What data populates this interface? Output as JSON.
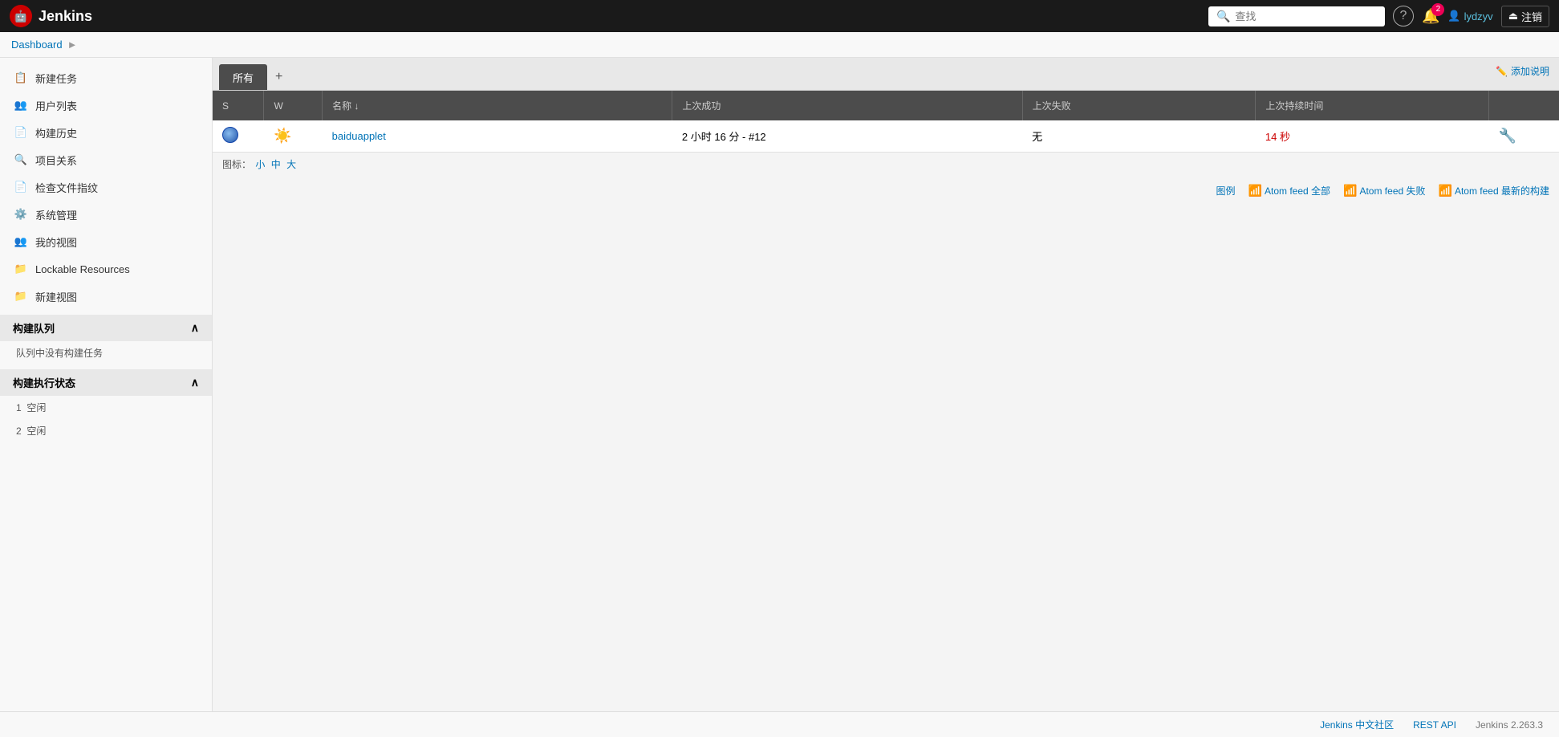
{
  "topnav": {
    "logo_text": "Jenkins",
    "search_placeholder": "查找",
    "notifications_count": "2",
    "user_name": "lydzyv",
    "logout_label": "注销"
  },
  "breadcrumb": {
    "dashboard_label": "Dashboard",
    "separator": "►"
  },
  "sidebar": {
    "items": [
      {
        "id": "new-task",
        "label": "新建任务",
        "icon": "📋"
      },
      {
        "id": "users",
        "label": "用户列表",
        "icon": "👥"
      },
      {
        "id": "build-history",
        "label": "构建历史",
        "icon": "📄"
      },
      {
        "id": "project-relations",
        "label": "项目关系",
        "icon": "🔍"
      },
      {
        "id": "check-file-fingerprint",
        "label": "检查文件指纹",
        "icon": "📄"
      },
      {
        "id": "system-management",
        "label": "系统管理",
        "icon": "⚙️"
      },
      {
        "id": "my-views",
        "label": "我的视图",
        "icon": "👥"
      },
      {
        "id": "lockable-resources",
        "label": "Lockable Resources",
        "icon": "📁"
      },
      {
        "id": "new-view",
        "label": "新建视图",
        "icon": "📁"
      }
    ],
    "build_queue_section": "构建队列",
    "build_queue_empty": "队列中没有构建任务",
    "build_executor_section": "构建执行状态",
    "executors": [
      {
        "id": 1,
        "status": "空闲"
      },
      {
        "id": 2,
        "status": "空闲"
      }
    ]
  },
  "main": {
    "add_desc_label": "添加说明",
    "tabs": [
      {
        "id": "all",
        "label": "所有",
        "active": true
      },
      {
        "id": "add",
        "label": "+"
      }
    ],
    "table": {
      "headers": [
        "S",
        "W",
        "名称 ↓",
        "上次成功",
        "上次失败",
        "上次持续时间",
        ""
      ],
      "rows": [
        {
          "status": "globe",
          "weather": "sun",
          "name": "baiduapplet",
          "last_success": "2 小时 16 分 - #12",
          "last_failure": "无",
          "last_duration": "14 秒",
          "actions": ""
        }
      ]
    },
    "icon_size_label": "图标：",
    "icon_sizes": [
      "小",
      "中",
      "大"
    ],
    "footer_links": {
      "legend_label": "图例",
      "atom_feed_all_label": "Atom feed 全部",
      "atom_feed_fail_label": "Atom feed 失败",
      "atom_feed_latest_label": "Atom feed 最新的构建"
    }
  },
  "footer": {
    "community_label": "Jenkins 中文社区",
    "rest_api_label": "REST API",
    "version_label": "Jenkins 2.263.3"
  }
}
